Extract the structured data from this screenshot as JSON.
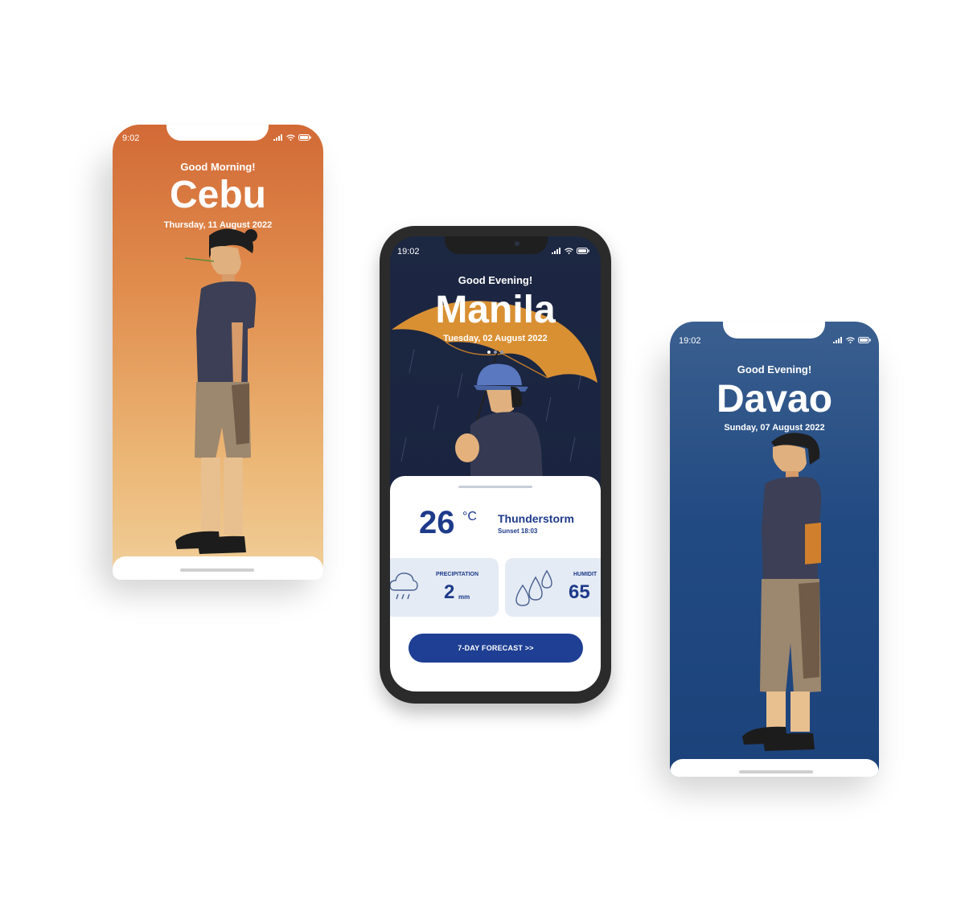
{
  "colors": {
    "cebu_top": "#d26a36",
    "cebu_bottom": "#f0cf9a",
    "manila_bg": "#1c2742",
    "davao_bg": "#224a82",
    "accent_navy": "#1e3f93",
    "umbrella": "#d99033",
    "card_bg": "#e4ebf4"
  },
  "screens": {
    "cebu": {
      "time": "9:02",
      "greeting": "Good Morning!",
      "city": "Cebu",
      "date": "Thursday, 11 August 2022"
    },
    "manila": {
      "time": "19:02",
      "greeting": "Good Evening!",
      "city": "Manila",
      "date": "Tuesday, 02 August 2022",
      "temperature": "26",
      "temp_unit": "°C",
      "condition": "Thunderstorm",
      "sunset": "Sunset 18:03",
      "cards": [
        {
          "label": "PRECIPITATION",
          "value": "2",
          "unit": "mm",
          "icon": "cloud-rain-icon"
        },
        {
          "label": "HUMIDIT",
          "value": "65",
          "unit": "",
          "icon": "droplets-icon"
        }
      ],
      "forecast_button": "7-DAY FORECAST >>"
    },
    "davao": {
      "time": "19:02",
      "greeting": "Good Evening!",
      "city": "Davao",
      "date": "Sunday, 07 August 2022"
    }
  },
  "icons": [
    "signal-icon",
    "wifi-icon",
    "battery-icon",
    "camera-icon"
  ]
}
